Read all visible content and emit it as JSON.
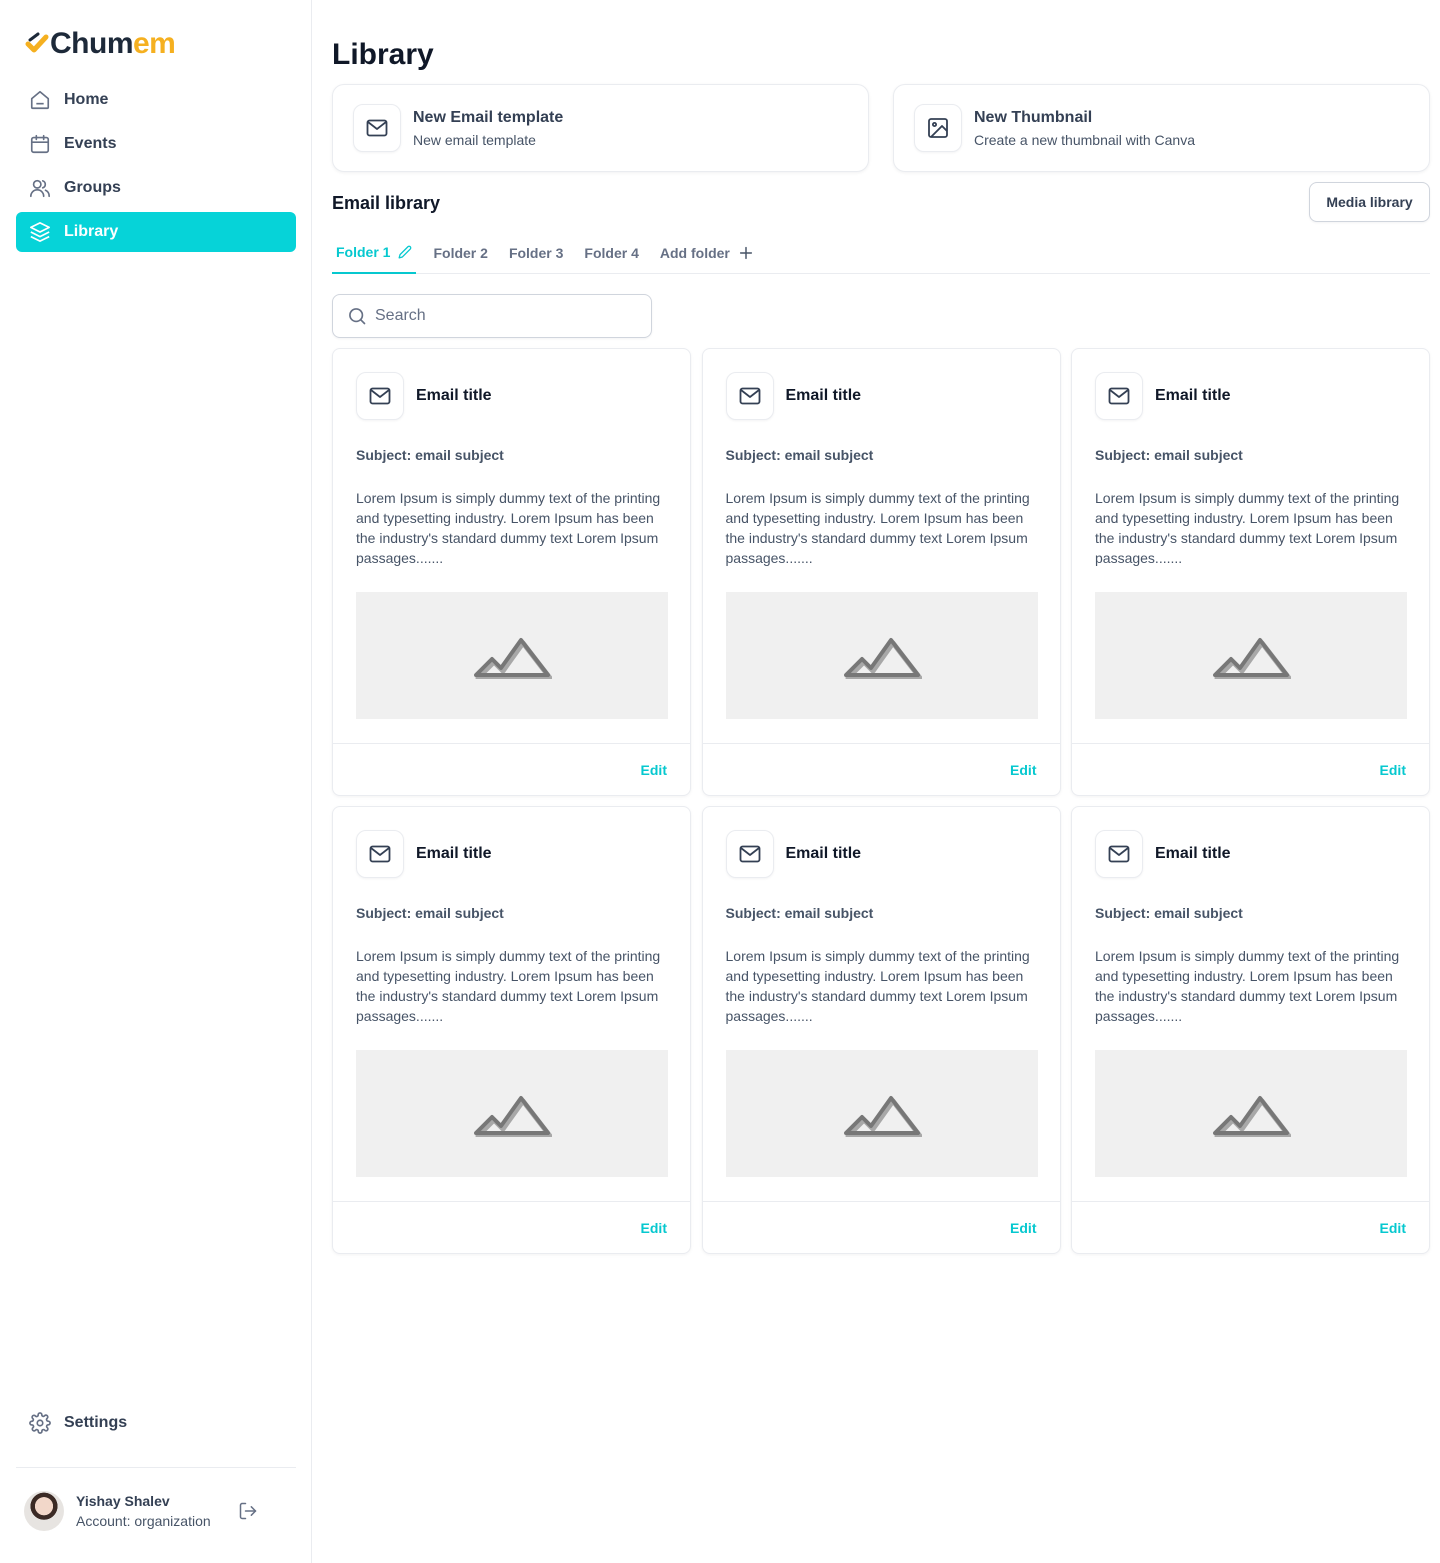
{
  "brand": {
    "name_main": "Chum",
    "name_accent": "em",
    "accent_color": "#f5b020",
    "primary_color": "#06d3d8"
  },
  "sidebar": {
    "items": [
      {
        "label": "Home",
        "icon": "home-icon",
        "active": false
      },
      {
        "label": "Events",
        "icon": "calendar-icon",
        "active": false
      },
      {
        "label": "Groups",
        "icon": "users-icon",
        "active": false
      },
      {
        "label": "Library",
        "icon": "layers-icon",
        "active": true
      }
    ],
    "settings_label": "Settings",
    "user": {
      "name": "Yishay Shalev",
      "account": "Account: organization"
    }
  },
  "main": {
    "title": "Library",
    "quick_actions": [
      {
        "title": "New Email template",
        "subtitle": "New email template",
        "icon": "mail-icon"
      },
      {
        "title": "New Thumbnail",
        "subtitle": "Create a new thumbnail with Canva",
        "icon": "image-icon"
      }
    ],
    "section_title": "Email library",
    "media_button": "Media library",
    "tabs": [
      {
        "label": "Folder 1",
        "active": true
      },
      {
        "label": "Folder 2",
        "active": false
      },
      {
        "label": "Folder 3",
        "active": false
      },
      {
        "label": "Folder 4",
        "active": false
      },
      {
        "label": "Add folder",
        "active": false
      }
    ],
    "search_placeholder": "Search",
    "cards": [
      {
        "title": "Email title",
        "subject": "Subject: email subject",
        "body": "Lorem Ipsum is simply dummy text of the printing and typesetting industry. Lorem Ipsum has been the industry's standard dummy text Lorem Ipsum passages.......",
        "edit": "Edit"
      },
      {
        "title": "Email title",
        "subject": "Subject: email subject",
        "body": "Lorem Ipsum is simply dummy text of the printing and typesetting industry. Lorem Ipsum has been the industry's standard dummy text Lorem Ipsum passages.......",
        "edit": "Edit"
      },
      {
        "title": "Email title",
        "subject": "Subject: email subject",
        "body": "Lorem Ipsum is simply dummy text of the printing and typesetting industry. Lorem Ipsum has been the industry's standard dummy text Lorem Ipsum passages.......",
        "edit": "Edit"
      },
      {
        "title": "Email title",
        "subject": "Subject: email subject",
        "body": "Lorem Ipsum is simply dummy text of the printing and typesetting industry. Lorem Ipsum has been the industry's standard dummy text Lorem Ipsum passages.......",
        "edit": "Edit"
      },
      {
        "title": "Email title",
        "subject": "Subject: email subject",
        "body": "Lorem Ipsum is simply dummy text of the printing and typesetting industry. Lorem Ipsum has been the industry's standard dummy text Lorem Ipsum passages.......",
        "edit": "Edit"
      },
      {
        "title": "Email title",
        "subject": "Subject: email subject",
        "body": "Lorem Ipsum is simply dummy text of the printing and typesetting industry. Lorem Ipsum has been the industry's standard dummy text Lorem Ipsum passages.......",
        "edit": "Edit"
      }
    ]
  }
}
